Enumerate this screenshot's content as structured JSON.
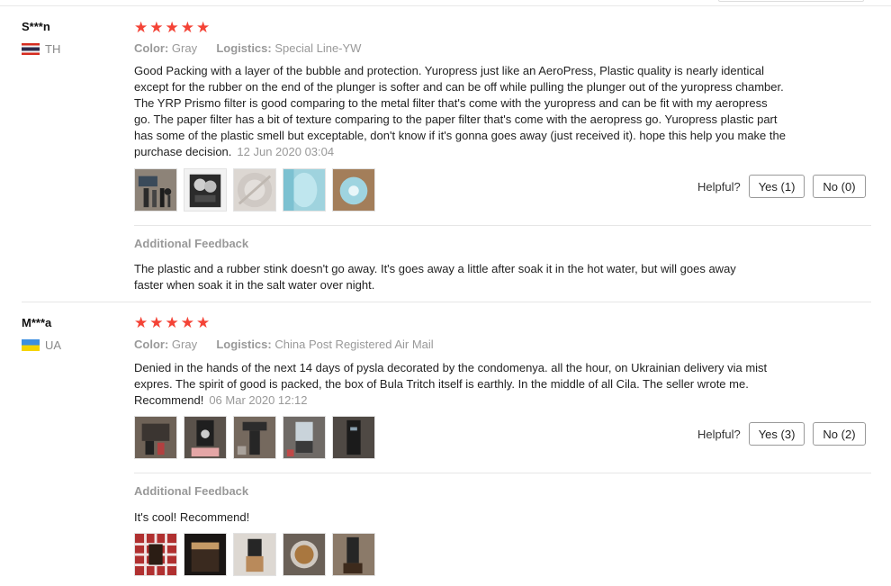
{
  "reviews": [
    {
      "user": "S***n",
      "country": "TH",
      "rating": 5,
      "meta": {
        "color_label": "Color:",
        "color_value": "Gray",
        "logistics_label": "Logistics:",
        "logistics_value": "Special Line-YW"
      },
      "text": "Good Packing with a layer of the bubble and protection. Yuropress just like an AeroPress, Plastic quality is nearly identical except for the rubber on the end of the plunger is softer and can be off while pulling the plunger out of the yuropress chamber. The YRP Prismo filter is good comparing to the metal filter that's come with the yuropress and can be fit with my aeropress go. The paper filter has a bit of texture comparing to the paper filter that's come with the aeropress go. Yuropress plastic part has some of the plastic smell but exceptable, don't know if it's gonna goes away (just received it). hope this help you make the purchase decision.",
      "date": "12 Jun 2020 03:04",
      "helpful_label": "Helpful?",
      "yes_label": "Yes (1)",
      "no_label": "No (0)",
      "additional_title": "Additional Feedback",
      "additional_text": "The plastic and a rubber stink doesn't go away. It's goes away a little after soak it in the hot water, but will goes away faster when soak it in the salt water over night."
    },
    {
      "user": "M***a",
      "country": "UA",
      "rating": 5,
      "meta": {
        "color_label": "Color:",
        "color_value": "Gray",
        "logistics_label": "Logistics:",
        "logistics_value": "China Post Registered Air Mail"
      },
      "text": "Denied in the hands of the next 14 days of pysla decorated by the condomenya. all the hour, on Ukrainian delivery via mist expres. The spirit of good is packed, the box of Bula Tritch itself is earthly. In the middle of all Cila. The seller wrote me. Recommend!",
      "date": "06 Mar 2020 12:12",
      "helpful_label": "Helpful?",
      "yes_label": "Yes (3)",
      "no_label": "No (2)",
      "additional_title": "Additional Feedback",
      "additional_text": "It's cool! Recommend!"
    }
  ],
  "colors": {
    "star": "#f44336",
    "muted": "#999999",
    "divider": "#e6e6e6"
  }
}
